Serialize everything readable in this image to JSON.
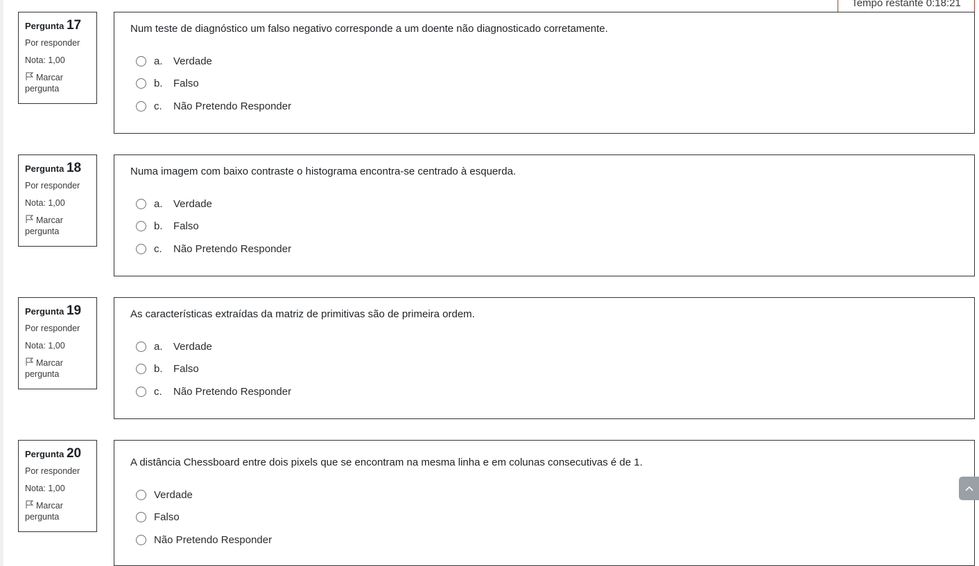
{
  "timer": {
    "label": "Tempo restante 0:18:21"
  },
  "common": {
    "flag_label": "Marcar pergunta"
  },
  "questions": [
    {
      "title_prefix": "Pergunta",
      "number": "17",
      "state": "Por responder",
      "grade": "Nota: 1,00",
      "text": "Num teste de diagnóstico um falso negativo corresponde a um doente não diagnosticado corretamente.",
      "answers": [
        {
          "letter": "a.",
          "label": "Verdade"
        },
        {
          "letter": "b.",
          "label": "Falso"
        },
        {
          "letter": "c.",
          "label": "Não Pretendo Responder"
        }
      ]
    },
    {
      "title_prefix": "Pergunta",
      "number": "18",
      "state": "Por responder",
      "grade": "Nota: 1,00",
      "text": "Numa imagem com baixo contraste o histograma encontra-se centrado à esquerda.",
      "answers": [
        {
          "letter": "a.",
          "label": "Verdade"
        },
        {
          "letter": "b.",
          "label": "Falso"
        },
        {
          "letter": "c.",
          "label": "Não Pretendo Responder"
        }
      ]
    },
    {
      "title_prefix": "Pergunta",
      "number": "19",
      "state": "Por responder",
      "grade": "Nota: 1,00",
      "text": "As características extraídas da matriz de primitivas são de primeira ordem.",
      "answers": [
        {
          "letter": "a.",
          "label": "Verdade"
        },
        {
          "letter": "b.",
          "label": "Falso"
        },
        {
          "letter": "c.",
          "label": "Não Pretendo Responder"
        }
      ]
    },
    {
      "title_prefix": "Pergunta",
      "number": "20",
      "state": "Por responder",
      "grade": "Nota: 1,00",
      "text": "A distância Chessboard entre dois pixels que se encontram na mesma linha e em colunas consecutivas é de 1.",
      "answers": [
        {
          "letter": "",
          "label": "Verdade"
        },
        {
          "letter": "",
          "label": "Falso"
        },
        {
          "letter": "",
          "label": "Não Pretendo Responder"
        }
      ]
    }
  ],
  "icons": {
    "flag": "flag-outline-icon",
    "scroll_top": "chevron-up-icon"
  },
  "colors": {
    "timer_border": "#b23b2a",
    "scroll_button": "#9aa0a6",
    "border": "#333333"
  }
}
